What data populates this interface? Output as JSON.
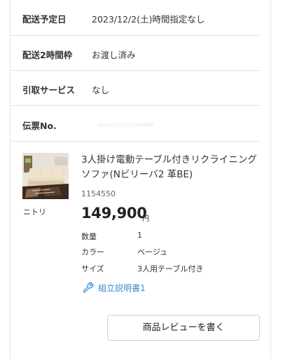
{
  "delivery": {
    "rows": [
      {
        "label": "配送予定日",
        "value": "2023/12/2(土)時間指定なし"
      },
      {
        "label": "配送2時間枠",
        "value": "お渡し済み"
      },
      {
        "label": "引取サービス",
        "value": "なし"
      },
      {
        "label": "伝票No.",
        "value": ""
      }
    ]
  },
  "product": {
    "image_icon": "sofa-product-photo",
    "maker": "ニトリ",
    "name": "3人掛け電動テーブル付きリクライニングソファ(Nビリーバ2 革BE)",
    "code": "1154550",
    "price": "149,900",
    "currency": "円",
    "specs": [
      {
        "label": "数量",
        "value": "1"
      },
      {
        "label": "カラー",
        "value": "ベージュ"
      },
      {
        "label": "サイズ",
        "value": "3人用テーブル付き"
      }
    ],
    "manual_icon": "wrench-icon",
    "manual_link": "組立説明書1",
    "accent_color": "#3c8bd1"
  },
  "actions": {
    "review_button": "商品レビューを書く"
  }
}
